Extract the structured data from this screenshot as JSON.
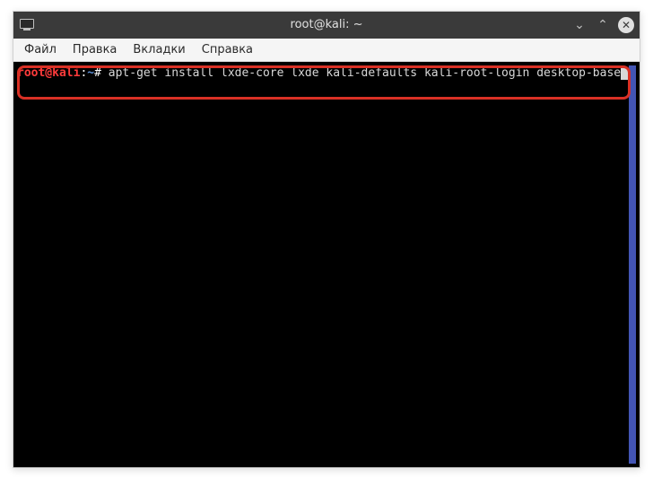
{
  "titlebar": {
    "title": "root@kali: ~"
  },
  "menubar": {
    "items": [
      {
        "label": "Файл"
      },
      {
        "label": "Правка"
      },
      {
        "label": "Вкладки"
      },
      {
        "label": "Справка"
      }
    ]
  },
  "terminal": {
    "prompt_user": "root@kali",
    "prompt_sep": ":",
    "prompt_path": "~",
    "prompt_hash": "#",
    "command": " apt-get install lxde-core lxde kali-defaults kali-root-login desktop-base"
  }
}
